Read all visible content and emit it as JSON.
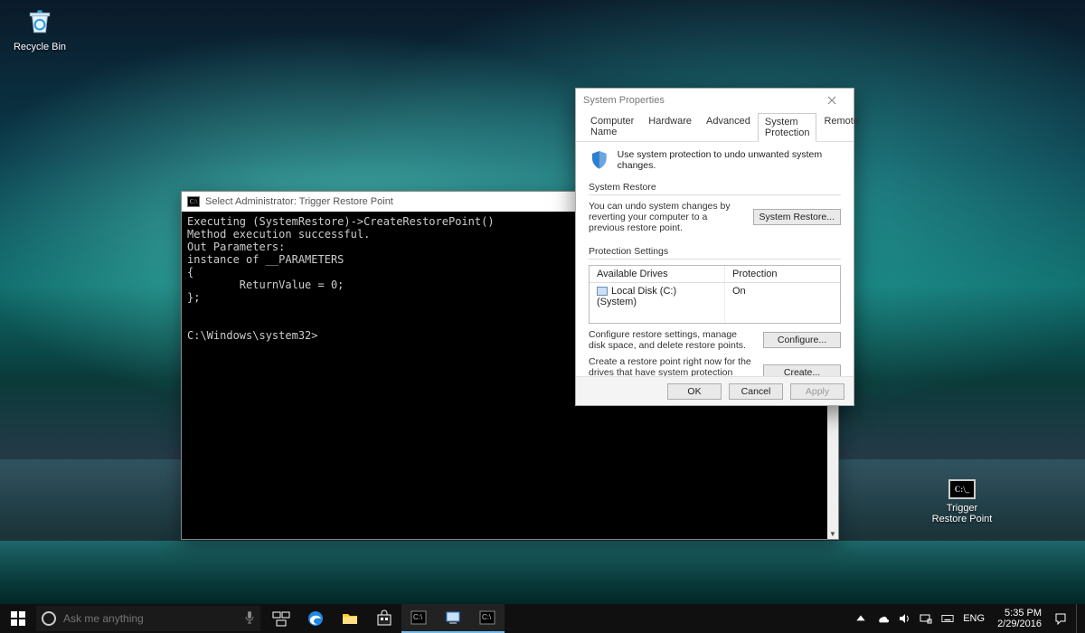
{
  "desktop": {
    "icons": {
      "recycle_bin": "Recycle Bin",
      "trigger_restore": "Trigger\nRestore Point"
    }
  },
  "cmd": {
    "title": "Select Administrator: Trigger Restore Point",
    "lines": [
      "Executing (SystemRestore)->CreateRestorePoint()",
      "Method execution successful.",
      "Out Parameters:",
      "instance of __PARAMETERS",
      "{",
      "        ReturnValue = 0;",
      "};",
      "",
      "",
      "C:\\Windows\\system32>"
    ]
  },
  "sysprops": {
    "title": "System Properties",
    "tabs": [
      "Computer Name",
      "Hardware",
      "Advanced",
      "System Protection",
      "Remote"
    ],
    "active_tab_index": 3,
    "intro": "Use system protection to undo unwanted system changes.",
    "restore": {
      "group": "System Restore",
      "text": "You can undo system changes by reverting your computer to a previous restore point.",
      "button": "System Restore..."
    },
    "protection": {
      "group": "Protection Settings",
      "header_drives": "Available Drives",
      "header_prot": "Protection",
      "drive_name": "Local Disk (C:) (System)",
      "drive_protection": "On",
      "configure_text": "Configure restore settings, manage disk space, and delete restore points.",
      "configure_button": "Configure...",
      "create_text": "Create a restore point right now for the drives that have system protection turned on.",
      "create_button": "Create..."
    },
    "buttons": {
      "ok": "OK",
      "cancel": "Cancel",
      "apply": "Apply"
    }
  },
  "taskbar": {
    "search_placeholder": "Ask me anything",
    "lang": "ENG",
    "time": "5:35 PM",
    "date": "2/29/2016"
  }
}
